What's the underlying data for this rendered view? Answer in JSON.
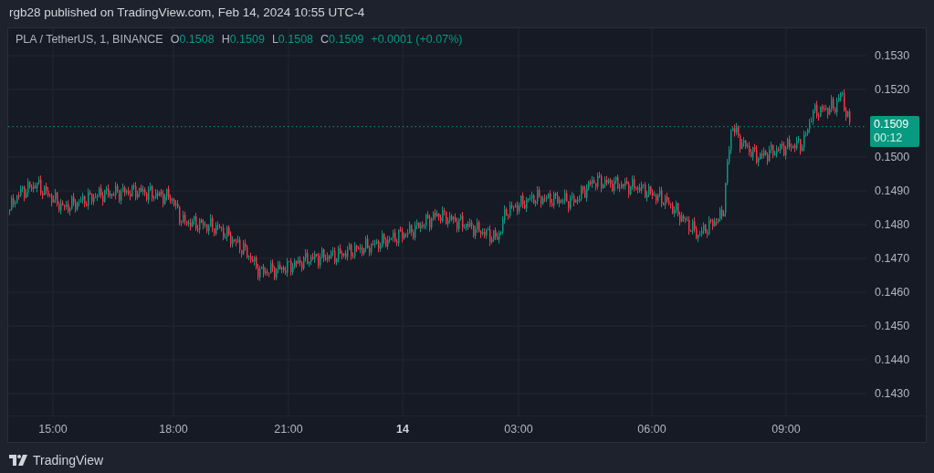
{
  "header": {
    "text": "rgb28 published on TradingView.com, Feb 14, 2024 10:55 UTC-4"
  },
  "legend": {
    "symbol": "PLA / TetherUS, 1, BINANCE",
    "rising": true,
    "ohlc": [
      {
        "label": "O",
        "value": "0.1508"
      },
      {
        "label": "H",
        "value": "0.1509"
      },
      {
        "label": "L",
        "value": "0.1508"
      },
      {
        "label": "C",
        "value": "0.1509"
      }
    ],
    "change": "+0.0001 (+0.07%)"
  },
  "price_axis": {
    "ticks": [
      "0.1530",
      "0.1520",
      "0.1500",
      "0.1490",
      "0.1480",
      "0.1470",
      "0.1460",
      "0.1450",
      "0.1440",
      "0.1430"
    ]
  },
  "last_price": {
    "price": "0.1509",
    "countdown": "00:12",
    "rising": true
  },
  "time_axis": {
    "ticks": [
      {
        "label": "15:00",
        "kind": "time"
      },
      {
        "label": "18:00",
        "kind": "time"
      },
      {
        "label": "21:00",
        "kind": "time"
      },
      {
        "label": "14",
        "kind": "day"
      },
      {
        "label": "03:00",
        "kind": "time"
      },
      {
        "label": "06:00",
        "kind": "time"
      },
      {
        "label": "09:00",
        "kind": "time"
      }
    ]
  },
  "footer": {
    "brand": "TradingView"
  }
}
